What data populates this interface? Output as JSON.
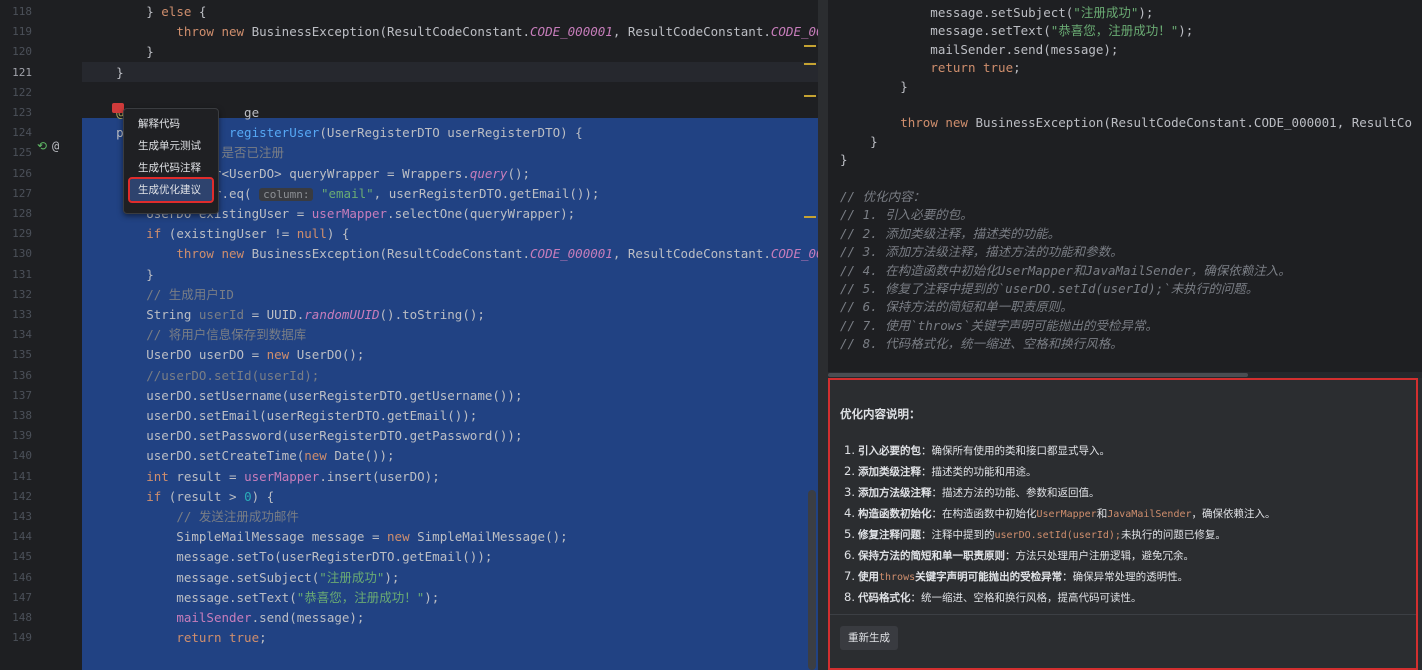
{
  "editor": {
    "line_numbers": [
      "118",
      "119",
      "120",
      "121",
      "122",
      "123",
      "124",
      "125",
      "126",
      "127",
      "128",
      "129",
      "130",
      "131",
      "132",
      "133",
      "134",
      "135",
      "136",
      "137",
      "138",
      "139",
      "140",
      "141",
      "142",
      "143",
      "144",
      "145",
      "146",
      "147",
      "148",
      "149"
    ],
    "current_line": "121",
    "lines": [
      [
        {
          "t": "        } "
        },
        {
          "t": "else",
          "c": "kw"
        },
        {
          "t": " {"
        }
      ],
      [
        {
          "t": "            "
        },
        {
          "t": "throw new",
          "c": "kw"
        },
        {
          "t": " BusinessException(ResultCodeConstant."
        },
        {
          "t": "CODE_000001",
          "c": "cst"
        },
        {
          "t": ", ResultCodeConstant."
        },
        {
          "t": "CODE_0000",
          "c": "cst"
        }
      ],
      [
        {
          "t": "        }"
        }
      ],
      [
        {
          "t": "    }"
        }
      ],
      [
        {
          "t": ""
        }
      ],
      [
        {
          "t": "    "
        },
        {
          "t": "@C",
          "c": "ann"
        },
        {
          "t": "               ge"
        }
      ],
      [
        {
          "t": "    pu"
        },
        {
          "t": "             "
        },
        {
          "t": "registerUser",
          "c": "fn"
        },
        {
          "t": "(UserRegisterDTO userRegisterDTO) {"
        }
      ],
      [
        {
          "t": "                  "
        },
        {
          "t": "是否已注册",
          "c": "cm"
        }
      ],
      [
        {
          "t": "                 r<UserDO> queryWrapper = Wrappers."
        },
        {
          "t": "query",
          "c": "cst"
        },
        {
          "t": "();"
        }
      ],
      [
        {
          "t": "                 r.eq( "
        },
        {
          "t": "column:",
          "c": "hint"
        },
        {
          "t": " "
        },
        {
          "t": "\"email\"",
          "c": "str"
        },
        {
          "t": ", userRegisterDTO.getEmail());"
        }
      ],
      [
        {
          "t": "        UserDO existingUser = "
        },
        {
          "t": "userMapper",
          "c": "fld"
        },
        {
          "t": ".selectOne(queryWrapper);"
        }
      ],
      [
        {
          "t": "        "
        },
        {
          "t": "if",
          "c": "kw"
        },
        {
          "t": " (existingUser != "
        },
        {
          "t": "null",
          "c": "kw"
        },
        {
          "t": ") {"
        }
      ],
      [
        {
          "t": "            "
        },
        {
          "t": "throw new",
          "c": "kw"
        },
        {
          "t": " BusinessException(ResultCodeConstant."
        },
        {
          "t": "CODE_000001",
          "c": "cst"
        },
        {
          "t": ", ResultCodeConstant."
        },
        {
          "t": "CODE_0000",
          "c": "cst"
        }
      ],
      [
        {
          "t": "        }"
        }
      ],
      [
        {
          "t": "        "
        },
        {
          "t": "// 生成用户ID",
          "c": "cm"
        }
      ],
      [
        {
          "t": "        String "
        },
        {
          "t": "userId",
          "c": "cm"
        },
        {
          "t": " = UUID."
        },
        {
          "t": "randomUUID",
          "c": "cst"
        },
        {
          "t": "().toString();"
        }
      ],
      [
        {
          "t": "        "
        },
        {
          "t": "// 将用户信息保存到数据库",
          "c": "cm"
        }
      ],
      [
        {
          "t": "        UserDO userDO = "
        },
        {
          "t": "new",
          "c": "kw"
        },
        {
          "t": " UserDO();"
        }
      ],
      [
        {
          "t": "        "
        },
        {
          "t": "//userDO.setId(userId);",
          "c": "cm"
        }
      ],
      [
        {
          "t": "        userDO.setUsername(userRegisterDTO.getUsername());"
        }
      ],
      [
        {
          "t": "        userDO.setEmail(userRegisterDTO.getEmail());"
        }
      ],
      [
        {
          "t": "        userDO.setPassword(userRegisterDTO.getPassword());"
        }
      ],
      [
        {
          "t": "        userDO.setCreateTime("
        },
        {
          "t": "new",
          "c": "kw"
        },
        {
          "t": " Date());"
        }
      ],
      [
        {
          "t": "        "
        },
        {
          "t": "int",
          "c": "kw"
        },
        {
          "t": " result = "
        },
        {
          "t": "userMapper",
          "c": "fld"
        },
        {
          "t": ".insert(userDO);"
        }
      ],
      [
        {
          "t": "        "
        },
        {
          "t": "if",
          "c": "kw"
        },
        {
          "t": " (result > "
        },
        {
          "t": "0",
          "c": "num"
        },
        {
          "t": ") {"
        }
      ],
      [
        {
          "t": "            "
        },
        {
          "t": "// 发送注册成功邮件",
          "c": "cm"
        }
      ],
      [
        {
          "t": "            SimpleMailMessage message = "
        },
        {
          "t": "new",
          "c": "kw"
        },
        {
          "t": " SimpleMailMessage();"
        }
      ],
      [
        {
          "t": "            message.setTo(userRegisterDTO.getEmail());"
        }
      ],
      [
        {
          "t": "            message.setSubject("
        },
        {
          "t": "\"注册成功\"",
          "c": "str"
        },
        {
          "t": ");"
        }
      ],
      [
        {
          "t": "            message.setText("
        },
        {
          "t": "\"恭喜您，注册成功！\"",
          "c": "str"
        },
        {
          "t": ");"
        }
      ],
      [
        {
          "t": "            "
        },
        {
          "t": "mailSender",
          "c": "fld"
        },
        {
          "t": ".send(message);"
        }
      ],
      [
        {
          "t": "            "
        },
        {
          "t": "return true",
          "c": "kw"
        },
        {
          "t": ";"
        }
      ]
    ]
  },
  "context_menu": {
    "items": [
      "解释代码",
      "生成单元测试",
      "生成代码注释",
      "生成优化建议"
    ],
    "active_index": 3
  },
  "right_code": {
    "lines": [
      [
        {
          "t": "            message.setSubject("
        },
        {
          "t": "\"注册成功\"",
          "c": "str"
        },
        {
          "t": ");"
        }
      ],
      [
        {
          "t": "            message.setText("
        },
        {
          "t": "\"恭喜您，注册成功！\"",
          "c": "str"
        },
        {
          "t": ");"
        }
      ],
      [
        {
          "t": "            mailSender.send(message);"
        }
      ],
      [
        {
          "t": "            "
        },
        {
          "t": "return true",
          "c": "kw"
        },
        {
          "t": ";"
        }
      ],
      [
        {
          "t": "        }"
        }
      ],
      [
        {
          "t": ""
        }
      ],
      [
        {
          "t": "        "
        },
        {
          "t": "throw new",
          "c": "kw"
        },
        {
          "t": " BusinessException(ResultCodeConstant.CODE_000001, ResultCo"
        }
      ],
      [
        {
          "t": "    }"
        }
      ],
      [
        {
          "t": "}"
        }
      ],
      [
        {
          "t": ""
        }
      ],
      [
        {
          "t": "// 优化内容：",
          "c": "rcm"
        }
      ],
      [
        {
          "t": "// 1. 引入必要的包。",
          "c": "rcm"
        }
      ],
      [
        {
          "t": "// 2. 添加类级注释，描述类的功能。",
          "c": "rcm"
        }
      ],
      [
        {
          "t": "// 3. 添加方法级注释，描述方法的功能和参数。",
          "c": "rcm"
        }
      ],
      [
        {
          "t": "// 4. 在构造函数中初始化UserMapper和JavaMailSender，确保依赖注入。",
          "c": "rcm"
        }
      ],
      [
        {
          "t": "// 5. 修复了注释中提到的`userDO.setId(userId);`未执行的问题。",
          "c": "rcm"
        }
      ],
      [
        {
          "t": "// 6. 保持方法的简短和单一职责原则。",
          "c": "rcm"
        }
      ],
      [
        {
          "t": "// 7. 使用`throws`关键字声明可能抛出的受检异常。",
          "c": "rcm"
        }
      ],
      [
        {
          "t": "// 8. 代码格式化，统一缩进、空格和换行风格。",
          "c": "rcm"
        }
      ]
    ]
  },
  "panel": {
    "title": "优化内容说明：",
    "items": [
      {
        "num": "1.",
        "parts": [
          {
            "t": "引入必要的包",
            "b": true
          },
          {
            "t": "：确保所有使用的类和接口都显式导入。"
          }
        ]
      },
      {
        "num": "2.",
        "parts": [
          {
            "t": "添加类级注释",
            "b": true
          },
          {
            "t": "：描述类的功能和用途。"
          }
        ]
      },
      {
        "num": "3.",
        "parts": [
          {
            "t": "添加方法级注释",
            "b": true
          },
          {
            "t": "：描述方法的功能、参数和返回值。"
          }
        ]
      },
      {
        "num": "4.",
        "parts": [
          {
            "t": "构造函数初始化",
            "b": true
          },
          {
            "t": "：在构造函数中初始化"
          },
          {
            "t": "UserMapper",
            "c": true
          },
          {
            "t": "和"
          },
          {
            "t": "JavaMailSender",
            "c": true
          },
          {
            "t": "，确保依赖注入。"
          }
        ]
      },
      {
        "num": "5.",
        "parts": [
          {
            "t": "修复注释问题",
            "b": true
          },
          {
            "t": "：注释中提到的"
          },
          {
            "t": "userDO.setId(userId);",
            "c": true
          },
          {
            "t": "未执行的问题已修复。"
          }
        ]
      },
      {
        "num": "6.",
        "parts": [
          {
            "t": "保持方法的简短和单一职责原则",
            "b": true
          },
          {
            "t": "：方法只处理用户注册逻辑，避免冗余。"
          }
        ]
      },
      {
        "num": "7.",
        "parts": [
          {
            "t": "使用",
            "b": true
          },
          {
            "t": "throws",
            "c": true
          },
          {
            "t": "关键字声明可能抛出的受检异常",
            "b": true
          },
          {
            "t": "：确保异常处理的透明性。"
          }
        ]
      },
      {
        "num": "8.",
        "parts": [
          {
            "t": "代码格式化",
            "b": true
          },
          {
            "t": "：统一缩进、空格和换行风格，提高代码可读性。"
          }
        ]
      }
    ],
    "regenerate_label": "重新生成"
  },
  "colors": {
    "accent_border": "#d32f2f",
    "selection": "#214283"
  }
}
